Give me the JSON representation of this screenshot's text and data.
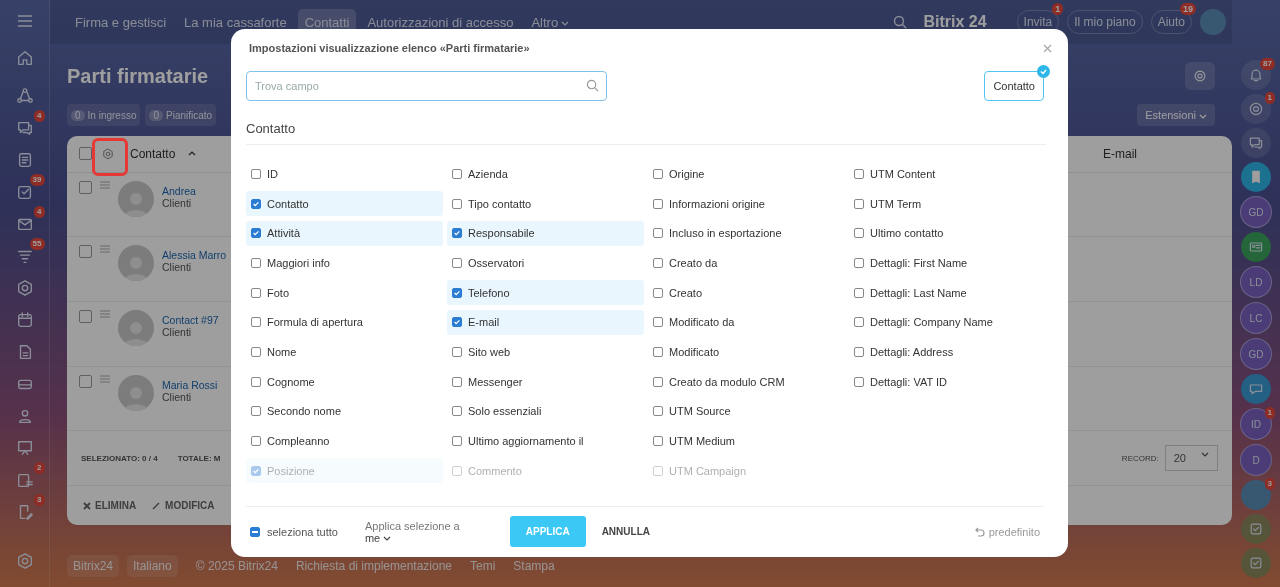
{
  "left_rail": {
    "items": [
      {
        "kind": "home"
      },
      {
        "kind": "flow"
      },
      {
        "kind": "chat",
        "badge": "4"
      },
      {
        "kind": "feed"
      },
      {
        "kind": "tasks",
        "badge": "39"
      },
      {
        "kind": "mail",
        "badge": "4"
      },
      {
        "kind": "funnel",
        "badge": "55"
      },
      {
        "kind": "hexagon"
      },
      {
        "kind": "calendar"
      },
      {
        "kind": "document"
      },
      {
        "kind": "drive"
      },
      {
        "kind": "people"
      },
      {
        "kind": "board"
      },
      {
        "kind": "checklist",
        "badge": "2"
      },
      {
        "kind": "sign",
        "badge": "3"
      }
    ]
  },
  "top_bar": {
    "tabs": [
      {
        "label": "Firma e gestisci",
        "selected": false
      },
      {
        "label": "La mia cassaforte",
        "selected": false
      },
      {
        "label": "Contatti",
        "selected": true
      },
      {
        "label": "Autorizzazioni di accesso",
        "selected": false
      }
    ],
    "more": "Altro",
    "logo": "Bitrix 24",
    "buttons": [
      {
        "label": "Invita",
        "badge": "1"
      },
      {
        "label": "Il mio piano"
      },
      {
        "label": "Aiuto",
        "badge": "19"
      }
    ]
  },
  "page": {
    "title": "Parti firmatarie",
    "counters": [
      {
        "count": "0",
        "label": "In ingresso"
      },
      {
        "count": "0",
        "label": "Pianificato"
      }
    ],
    "extensions": "Estensioni"
  },
  "table": {
    "settings_highlighted": true,
    "all_checked": false,
    "columns": [
      "Contatto",
      "E-mail"
    ],
    "rows": [
      {
        "name": "Andrea",
        "type": "Clienti",
        "checked": false
      },
      {
        "name": "Alessia Marro",
        "type": "Clienti",
        "checked": false
      },
      {
        "name": "Contact #97",
        "type": "Clienti",
        "checked": false
      },
      {
        "name": "Maria Rossi",
        "type": "Clienti",
        "checked": false
      }
    ],
    "selected_label": "SELEZIONATO:",
    "selected": "0 / 4",
    "total": "TOTALE: M",
    "record_label": "RECORD:",
    "record": "20",
    "actions": [
      {
        "kind": "delete",
        "label": "ELIMINA"
      },
      {
        "kind": "edit",
        "label": "MODIFICA"
      }
    ]
  },
  "footer": {
    "buttons": [
      "Bitrix24",
      "Italiano"
    ],
    "links": [
      "© 2025 Bitrix24",
      "Richiesta di implementazione",
      "Temi",
      "Stampa"
    ]
  },
  "right_rail": {
    "items": [
      {
        "kind": "bell",
        "badge": "87"
      },
      {
        "kind": "target",
        "badge": "1"
      },
      {
        "kind": "chat"
      },
      {
        "kind": "bookmark"
      },
      {
        "kind": "initials",
        "text": "GD"
      },
      {
        "kind": "card"
      },
      {
        "kind": "initials",
        "text": "LD"
      },
      {
        "kind": "initials",
        "text": "LC"
      },
      {
        "kind": "initials",
        "text": "GD"
      },
      {
        "kind": "bubble"
      },
      {
        "kind": "initials",
        "text": "ID",
        "badge": "1"
      },
      {
        "kind": "initials",
        "text": "D"
      },
      {
        "kind": "avatar",
        "badge": "3"
      },
      {
        "kind": "check"
      },
      {
        "kind": "check"
      }
    ]
  },
  "dialog": {
    "title": "Impostazioni visualizzazione elenco «Parti firmatarie»",
    "search": {
      "placeholder": "Trova campo"
    },
    "chips": [
      {
        "label": "Contatto",
        "selected": true
      }
    ],
    "section": "Contatto",
    "fields": [
      {
        "label": "ID",
        "checked": false
      },
      {
        "label": "Contatto",
        "checked": true
      },
      {
        "label": "Attività",
        "checked": true
      },
      {
        "label": "Maggiori info",
        "checked": false
      },
      {
        "label": "Foto",
        "checked": false
      },
      {
        "label": "Formula di apertura",
        "checked": false
      },
      {
        "label": "Nome",
        "checked": false
      },
      {
        "label": "Cognome",
        "checked": false
      },
      {
        "label": "Secondo nome",
        "checked": false
      },
      {
        "label": "Compleanno",
        "checked": false
      },
      {
        "label": "Posizione",
        "checked": true
      },
      {
        "label": "Azienda",
        "checked": false
      },
      {
        "label": "Tipo contatto",
        "checked": false
      },
      {
        "label": "Responsabile",
        "checked": true
      },
      {
        "label": "Osservatori",
        "checked": false
      },
      {
        "label": "Telefono",
        "checked": true
      },
      {
        "label": "E-mail",
        "checked": true
      },
      {
        "label": "Sito web",
        "checked": false
      },
      {
        "label": "Messenger",
        "checked": false
      },
      {
        "label": "Solo essenziali",
        "checked": false
      },
      {
        "label": "Ultimo aggiornamento il",
        "checked": false
      },
      {
        "label": "Commento",
        "checked": false
      },
      {
        "label": "Origine",
        "checked": false
      },
      {
        "label": "Informazioni origine",
        "checked": false
      },
      {
        "label": "Incluso in esportazione",
        "checked": false
      },
      {
        "label": "Creato da",
        "checked": false
      },
      {
        "label": "Creato",
        "checked": false
      },
      {
        "label": "Modificato da",
        "checked": false
      },
      {
        "label": "Modificato",
        "checked": false
      },
      {
        "label": "Creato da modulo CRM",
        "checked": false
      },
      {
        "label": "UTM Source",
        "checked": false
      },
      {
        "label": "UTM Medium",
        "checked": false
      },
      {
        "label": "UTM Campaign",
        "checked": false
      },
      {
        "label": "UTM Content",
        "checked": false
      },
      {
        "label": "UTM Term",
        "checked": false
      },
      {
        "label": "Ultimo contatto",
        "checked": false
      },
      {
        "label": "Dettagli: First Name",
        "checked": false
      },
      {
        "label": "Dettagli: Last Name",
        "checked": false
      },
      {
        "label": "Dettagli: Company Name",
        "checked": false
      },
      {
        "label": "Dettagli: Address",
        "checked": false
      },
      {
        "label": "Dettagli: VAT ID",
        "checked": false
      }
    ],
    "select_all": {
      "label": "seleziona tutto",
      "indeterminate": true
    },
    "apply_to": {
      "label": "Applica selezione a",
      "value": "me"
    },
    "apply": "APPLICA",
    "cancel": "ANNULLA",
    "reset": "predefinito"
  }
}
